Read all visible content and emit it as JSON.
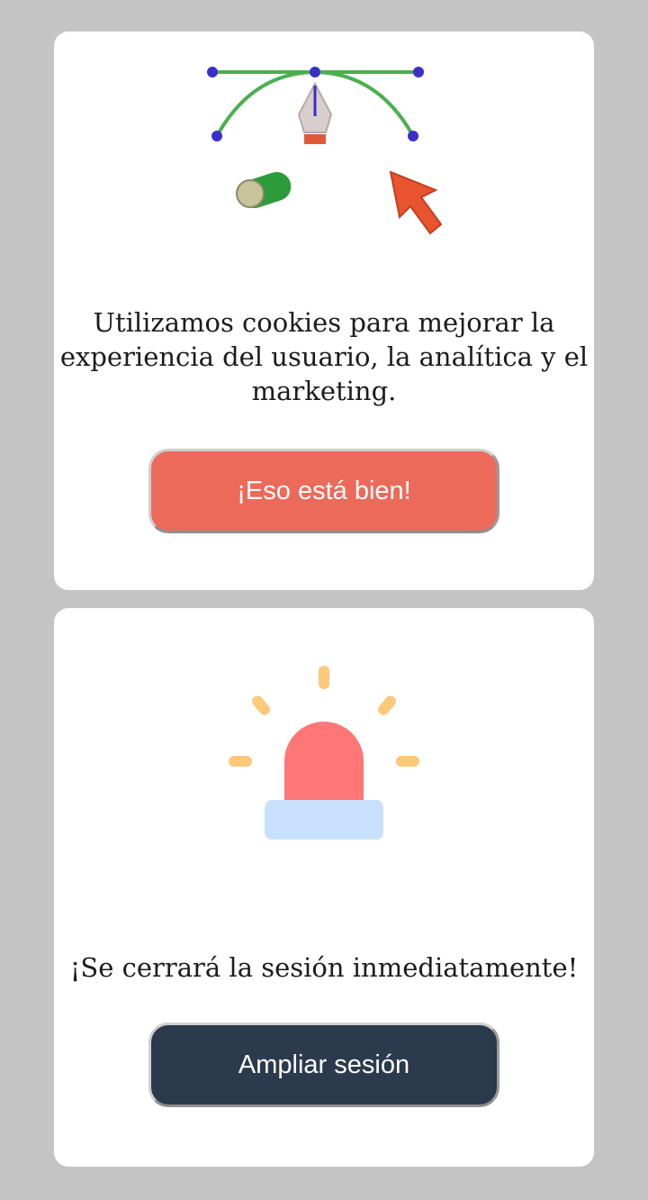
{
  "cookie_notice": {
    "message": "Utilizamos cookies para mejorar la experiencia del usuario, la analítica y el marketing.",
    "accept_label": "¡Eso está bien!",
    "illustration_icons": [
      "bezier-curve-icon",
      "pen-tool-icon",
      "toggle-icon",
      "cursor-arrow-icon"
    ],
    "accent_color": "#ec6a5a"
  },
  "session_notice": {
    "message": "¡Se cerrará la sesión inmediatamente!",
    "extend_label": "Ampliar sesión",
    "illustration_icons": [
      "alarm-light-icon"
    ],
    "button_color": "#2c3a4e"
  }
}
